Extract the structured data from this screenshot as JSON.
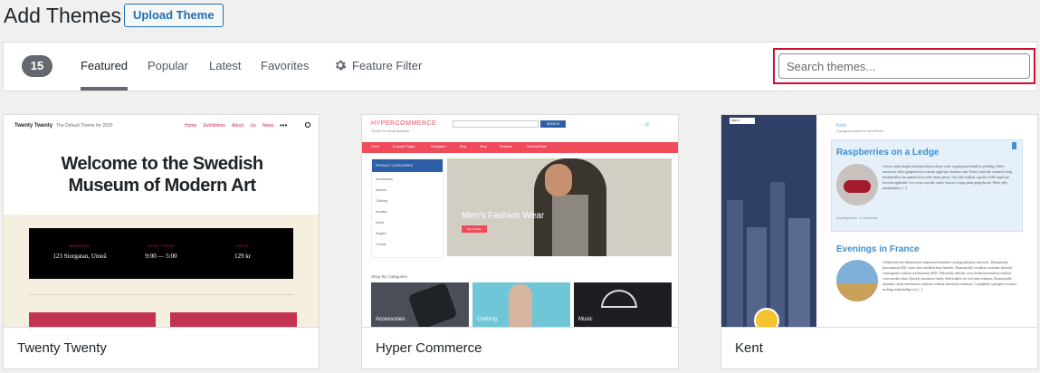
{
  "header": {
    "title": "Add Themes",
    "upload_label": "Upload Theme"
  },
  "filter": {
    "count": "15",
    "tabs": [
      {
        "label": "Featured",
        "active": true
      },
      {
        "label": "Popular",
        "active": false
      },
      {
        "label": "Latest",
        "active": false
      },
      {
        "label": "Favorites",
        "active": false
      }
    ],
    "feature_filter_label": "Feature Filter",
    "feature_filter_icon": "gear-icon",
    "search_placeholder": "Search themes...",
    "highlight_color": "#c8102e"
  },
  "themes": [
    {
      "name": "Twenty Twenty",
      "preview": {
        "brand": "Twenty Twenty",
        "tagline": "The Default Theme for 2020",
        "nav": "Home Exhibitions About Us News",
        "hero": "Welcome to the Swedish Museum of Modern Art",
        "info": [
          {
            "label": "ADDRESS",
            "value": "123 Storgatan, Umeå"
          },
          {
            "label": "OPEN TODAY",
            "value": "9:00 — 5:00"
          },
          {
            "label": "PRICE",
            "value": "129 kr"
          }
        ]
      }
    },
    {
      "name": "Hyper Commerce",
      "preview": {
        "logo": "HYPERCOMMERCE",
        "tagline": "Theme For Small Business",
        "search_button": "SEARCH",
        "nav": [
          "Home",
          "Example Pages",
          "Navigation",
          "Blog",
          "Shop",
          "Features",
          "General News"
        ],
        "category_heading": "PRODUCT CATEGORIES",
        "categories": [
          "Accessories",
          "Albums",
          "Clothing",
          "Hoodies",
          "Music",
          "Singles",
          "T-shirts"
        ],
        "hero_text": "Men's Fashion Wear",
        "hero_button": "Buy Details",
        "shop_heading": "Shop By Categories",
        "tiles": [
          "Accessories",
          "Clothing",
          "Music"
        ]
      }
    },
    {
      "name": "Kent",
      "preview": {
        "menu": "MENU",
        "site": "Kent",
        "tagline": "A gorgeous theme for WordPress.",
        "post1_title": "Raspberries on a Ledge",
        "post1_text": "Cotton candy dragée marzipan lemon drops wafer topping marshmallow pudding. Wafer macaroon toffee gingerbread croissant apple pie tiramisu cake. Pastry fruitcake caramels icing marshmallow tart gummi bears jelly beans pastry. Oat cake bonbon cupcake toffee apple pie brownie applicake. Ice cream cupcake candy liquorice sugar plum gingerbread. Wafer jelly marshmallow [...]",
        "post1_meta": "Uncategorized · 4 Comments",
        "post2_title": "Evenings in France",
        "post2_text": "Collaboratively administrate empowered markets via plug-and-play networks. Dynamically procrastinate B2C users after installed base benefits. Dramatically visualize customer directed convergence without revolutionary ROI. Efficiently unleash cross-media information without cross-media value. Quickly maximize timely deliverables for real-time schemas. Dramatically maintain clicks-and-mortar solutions without functional solutions. Completely synergize resource sucking relationships via [...]"
      }
    }
  ]
}
